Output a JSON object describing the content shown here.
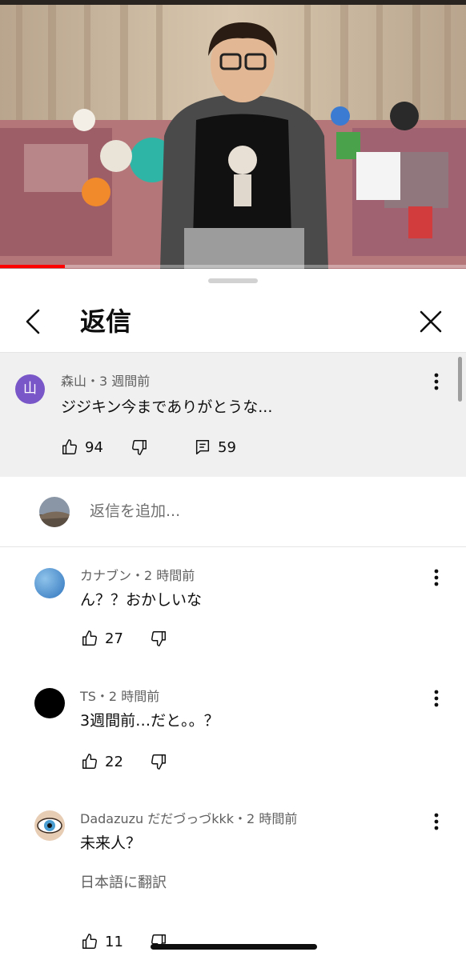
{
  "video": {
    "progress_fraction": 0.14
  },
  "panel": {
    "title": "返信"
  },
  "parent_comment": {
    "avatar_letter": "山",
    "meta": "森山・3 週間前",
    "text": "ジジキン今までありがとうな...",
    "likes": "94",
    "replies": "59"
  },
  "add_reply": {
    "placeholder": "返信を追加..."
  },
  "replies": [
    {
      "meta": "カナブン・2 時間前",
      "text": "ん？？おかしいな",
      "likes": "27"
    },
    {
      "meta": "TS・2 時間前",
      "text": "3週間前…だと。。？",
      "likes": "22"
    },
    {
      "meta": "Dadazuzu だだづっづkkk・2 時間前",
      "text": "未来人？",
      "translate_label": "日本語に翻訳",
      "likes": "11"
    }
  ],
  "icons": {
    "back": "chevron-left-icon",
    "close": "close-icon",
    "more": "more-vert-icon",
    "like": "thumb-up-icon",
    "dislike": "thumb-down-icon",
    "reply": "comment-icon"
  },
  "colors": {
    "accent_red": "#ff0000",
    "parent_bg": "#f0f0f0",
    "avatar_purple": "#7a57c9"
  }
}
